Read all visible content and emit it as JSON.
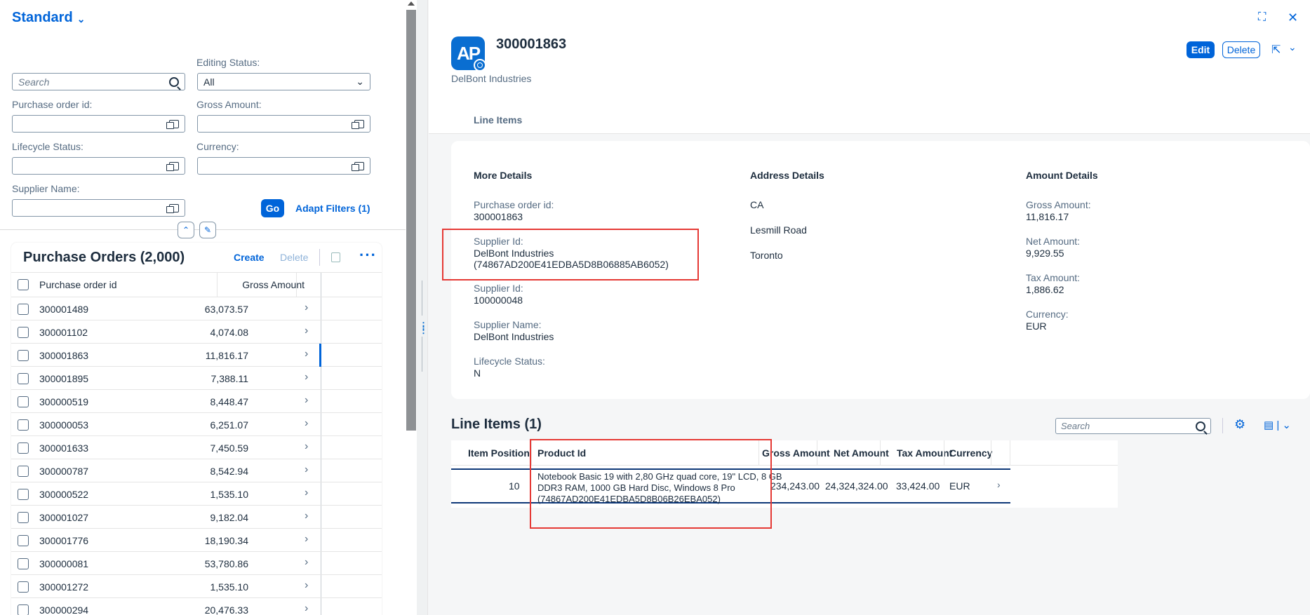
{
  "filterbar": {
    "variant": "Standard",
    "search_placeholder": "Search",
    "editing_status_label": "Editing Status:",
    "editing_status_value": "All",
    "po_id_label": "Purchase order id:",
    "gross_amount_label": "Gross Amount:",
    "lifecycle_label": "Lifecycle Status:",
    "currency_label": "Currency:",
    "supplier_name_label": "Supplier Name:",
    "go": "Go",
    "adapt_filters": "Adapt Filters (1)"
  },
  "po_table": {
    "title": "Purchase Orders (2,000)",
    "create": "Create",
    "delete": "Delete",
    "col_id": "Purchase order id",
    "col_amount": "Gross Amount",
    "rows": [
      {
        "id": "300001489",
        "amount": "63,073.57"
      },
      {
        "id": "300001102",
        "amount": "4,074.08"
      },
      {
        "id": "300001863",
        "amount": "11,816.17"
      },
      {
        "id": "300001895",
        "amount": "7,388.11"
      },
      {
        "id": "300000519",
        "amount": "8,448.47"
      },
      {
        "id": "300000053",
        "amount": "6,251.07"
      },
      {
        "id": "300001633",
        "amount": "7,450.59"
      },
      {
        "id": "300000787",
        "amount": "8,542.94"
      },
      {
        "id": "300000522",
        "amount": "1,535.10"
      },
      {
        "id": "300001027",
        "amount": "9,182.04"
      },
      {
        "id": "300001776",
        "amount": "18,190.34"
      },
      {
        "id": "300000081",
        "amount": "53,780.86"
      },
      {
        "id": "300001272",
        "amount": "1,535.10"
      },
      {
        "id": "300000294",
        "amount": "20,476.33"
      }
    ]
  },
  "object": {
    "avatar_initials": "AP",
    "title": "300001863",
    "subtitle": "DelBont Industries",
    "edit": "Edit",
    "delete": "Delete",
    "tab": "Line Items"
  },
  "more_details": {
    "heading": "More Details",
    "po_id_label": "Purchase order id:",
    "po_id": "300001863",
    "supplier_id_label": "Supplier Id:",
    "supplier_id_line1": "DelBont Industries",
    "supplier_id_line2": "(74867AD200E41EDBA5D8B06885AB6052)",
    "supplier_id2_label": "Supplier Id:",
    "supplier_id2": "100000048",
    "supplier_name_label": "Supplier Name:",
    "supplier_name": "DelBont Industries",
    "lifecycle_label": "Lifecycle Status:",
    "lifecycle": "N"
  },
  "address_details": {
    "heading": "Address Details",
    "line1": "CA",
    "line2": "Lesmill Road",
    "line3": "Toronto"
  },
  "amount_details": {
    "heading": "Amount Details",
    "gross_label": "Gross Amount:",
    "gross": "11,816.17",
    "net_label": "Net Amount:",
    "net": "9,929.55",
    "tax_label": "Tax Amount:",
    "tax": "1,886.62",
    "currency_label": "Currency:",
    "currency": "EUR"
  },
  "line_items": {
    "title": "Line Items (1)",
    "search_placeholder": "Search",
    "headers": {
      "item_position": "Item Position",
      "product_id": "Product Id",
      "gross": "Gross Amount",
      "net": "Net Amount",
      "tax": "Tax Amount",
      "currency": "Currency"
    },
    "row": {
      "item_position": "10",
      "product_line1": "Notebook Basic 19 with 2,80 GHz quad core, 19\" LCD, 8 GB",
      "product_line2": "DDR3 RAM, 1000 GB Hard Disc, Windows 8 Pro",
      "product_line3": "(74867AD200E41EDBA5D8B06B26EBA052)",
      "gross": "234,243.00",
      "net": "24,324,324.00",
      "tax": "33,424.00",
      "currency": "EUR"
    }
  },
  "colors": {
    "brand": "#0064d9",
    "highlight": "#e53935",
    "selected_row": "#0e3878"
  }
}
